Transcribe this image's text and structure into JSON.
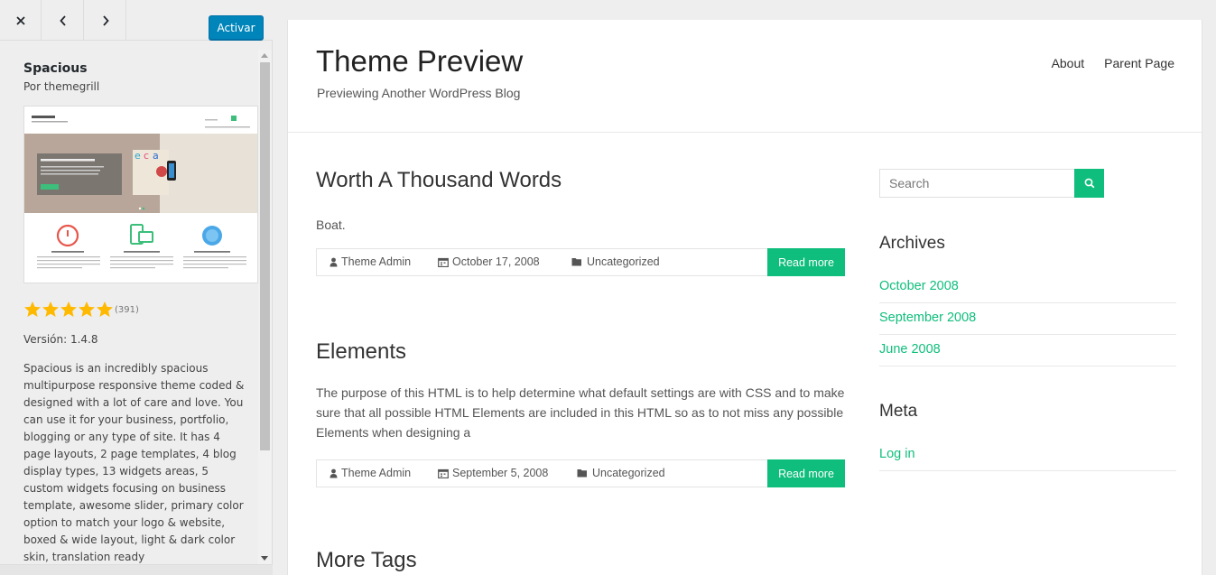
{
  "panel": {
    "activate_label": "Activar",
    "theme_name": "Spacious",
    "author": "Por themegrill",
    "rating_stars": 5,
    "rating_count": "(391)",
    "version": "Versión: 1.4.8",
    "description": "Spacious is an incredibly spacious multipurpose responsive theme coded & designed with a lot of care and love. You can use it for your business, portfolio, blogging or any type of site. It has 4 page layouts, 2 page templates, 4 blog display types, 13 widgets areas, 5 custom widgets focusing on business template, awesome slider, primary color option to match your logo & website, boxed & wide layout, light & dark color skin, translation ready"
  },
  "preview": {
    "site_title": "Theme Preview",
    "site_description": "Previewing Another WordPress Blog",
    "nav": [
      "About",
      "Parent Page"
    ],
    "posts": [
      {
        "title": "Worth A Thousand Words",
        "excerpt": "Boat.",
        "author": "Theme Admin",
        "date": "October 17, 2008",
        "category": "Uncategorized",
        "read_more": "Read more"
      },
      {
        "title": "Elements",
        "excerpt": "The purpose of this HTML is to help determine what default settings are with CSS and to make sure that all possible HTML Elements are included in this HTML so as to not miss any possible Elements when designing a",
        "author": "Theme Admin",
        "date": "September 5, 2008",
        "category": "Uncategorized",
        "read_more": "Read more"
      },
      {
        "title": "More Tags"
      }
    ],
    "sidebar": {
      "search_placeholder": "Search",
      "archives_title": "Archives",
      "archives": [
        "October 2008",
        "September 2008",
        "June 2008"
      ],
      "meta_title": "Meta",
      "meta_links": [
        "Log in"
      ]
    }
  },
  "colors": {
    "accent": "#0fbe7c",
    "wp_blue": "#0085ba",
    "star": "#ffb900"
  }
}
